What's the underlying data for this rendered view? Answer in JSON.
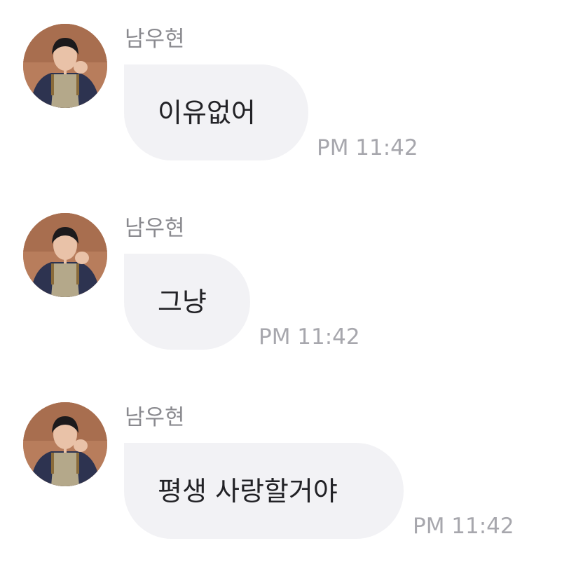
{
  "messages": [
    {
      "sender": "남우현",
      "text": "이유없어",
      "time": "PM 11:42"
    },
    {
      "sender": "남우현",
      "text": "그냥",
      "time": "PM 11:42"
    },
    {
      "sender": "남우현",
      "text": "평생 사랑할거야",
      "time": "PM 11:42"
    }
  ],
  "colors": {
    "bubble": "#f2f2f5",
    "sender": "#8a8a8f",
    "time": "#a7a7ad",
    "text": "#222226"
  }
}
